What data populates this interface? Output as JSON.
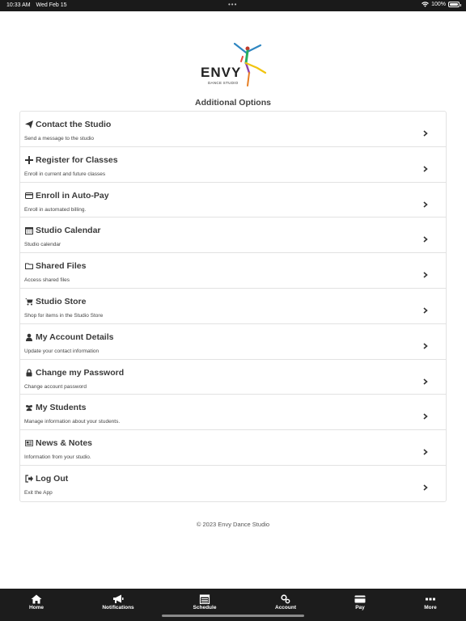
{
  "status": {
    "time": "10:33 AM",
    "date": "Wed Feb 15",
    "battery": "100%"
  },
  "logo": {
    "wordmark": "ENVY",
    "tagline": "DANCE STUDIO"
  },
  "page_title": "Additional Options",
  "options": [
    {
      "title": "Contact the Studio",
      "subtitle": "Send a message to the studio",
      "icon": "send-icon"
    },
    {
      "title": "Register for Classes",
      "subtitle": "Enroll in current and future classes",
      "icon": "plus-icon"
    },
    {
      "title": "Enroll in Auto-Pay",
      "subtitle": "Enroll in automated billing.",
      "icon": "credit-card-icon"
    },
    {
      "title": "Studio Calendar",
      "subtitle": "Studio calendar",
      "icon": "calendar-icon"
    },
    {
      "title": "Shared Files",
      "subtitle": "Access shared files",
      "icon": "folder-icon"
    },
    {
      "title": "Studio Store",
      "subtitle": "Shop for items in the Studio Store",
      "icon": "cart-icon"
    },
    {
      "title": "My Account Details",
      "subtitle": "Update your contact information",
      "icon": "user-icon"
    },
    {
      "title": "Change my Password",
      "subtitle": "Change account password",
      "icon": "lock-icon"
    },
    {
      "title": "My Students",
      "subtitle": "Manage information about your students.",
      "icon": "users-icon"
    },
    {
      "title": "News & Notes",
      "subtitle": "Information from your studio.",
      "icon": "newspaper-icon"
    },
    {
      "title": "Log Out",
      "subtitle": "Exit the App",
      "icon": "sign-out-icon"
    }
  ],
  "footer": "© 2023 Envy Dance Studio",
  "tabs": [
    {
      "label": "Home",
      "icon": "home-icon"
    },
    {
      "label": "Notifications",
      "icon": "megaphone-icon"
    },
    {
      "label": "Schedule",
      "icon": "schedule-icon"
    },
    {
      "label": "Account",
      "icon": "cogs-icon"
    },
    {
      "label": "Pay",
      "icon": "card-icon"
    },
    {
      "label": "More",
      "icon": "more-icon"
    }
  ],
  "colors": {
    "status_bar": "#1a1a1a",
    "tab_bar": "#1c1c1c",
    "border": "#e2e2e2",
    "text": "#3a3a3a"
  }
}
